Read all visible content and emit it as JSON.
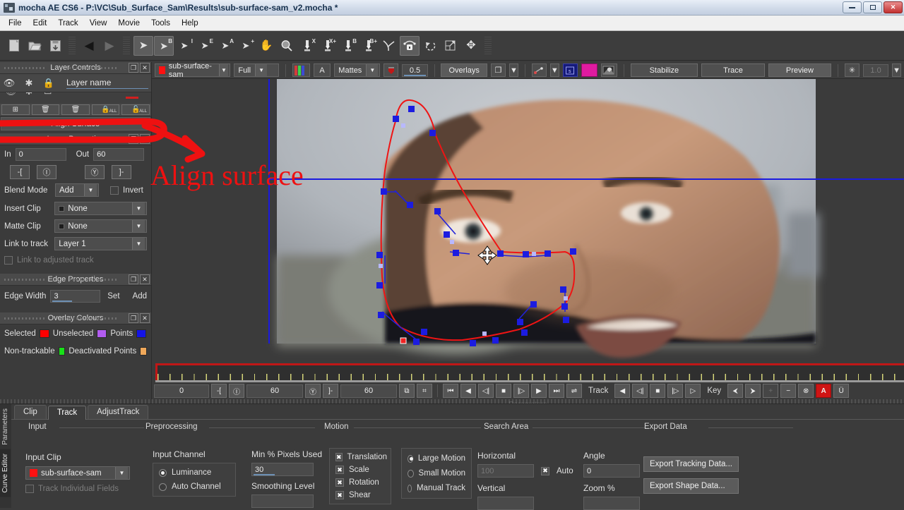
{
  "window": {
    "title": "mocha AE CS6 - P:\\VC\\Sub_Surface_Sam\\Results\\sub-surface-sam_v2.mocha *",
    "icon": "app-icon",
    "buttons": {
      "minimize": "–",
      "maximize": "▭",
      "close": "✕"
    }
  },
  "menu": {
    "items": [
      "File",
      "Edit",
      "Track",
      "View",
      "Movie",
      "Tools",
      "Help"
    ]
  },
  "toolbar": {
    "groups": [
      [
        {
          "name": "new-project-icon",
          "glyph": "🗋",
          "sup": ""
        },
        {
          "name": "open-project-icon",
          "glyph": "📁",
          "sup": ""
        },
        {
          "name": "save-project-icon",
          "glyph": "💾",
          "sup": ""
        }
      ],
      [
        {
          "name": "previous-icon",
          "glyph": "◀",
          "sup": ""
        },
        {
          "name": "next-icon",
          "glyph": "▶",
          "sup": ""
        }
      ],
      [
        {
          "name": "select-tool-icon",
          "glyph": "➤",
          "sup": "",
          "active": true
        },
        {
          "name": "select-b-tool-icon",
          "glyph": "➤",
          "sup": "B",
          "active": true
        },
        {
          "name": "select-i-tool-icon",
          "glyph": "➤",
          "sup": "I"
        },
        {
          "name": "select-e-tool-icon",
          "glyph": "➤",
          "sup": "E"
        },
        {
          "name": "select-a-tool-icon",
          "glyph": "➤",
          "sup": "A"
        },
        {
          "name": "add-point-tool-icon",
          "glyph": "➤",
          "sup": "+"
        }
      ],
      [
        {
          "name": "pan-hand-tool-icon",
          "glyph": "✋",
          "sup": ""
        },
        {
          "name": "zoom-tool-icon",
          "glyph": "🔍",
          "sup": ""
        },
        {
          "name": "xspline-tool-icon",
          "glyph": "✒",
          "sup": "X"
        },
        {
          "name": "xspline-add-tool-icon",
          "glyph": "✒",
          "sup": "X+"
        },
        {
          "name": "bezier-tool-icon",
          "glyph": "✒",
          "sup": "B"
        },
        {
          "name": "bezier-add-tool-icon",
          "glyph": "✒",
          "sup": "B+"
        },
        {
          "name": "magnetic-spline-tool-icon",
          "glyph": "⤵",
          "sup": ""
        },
        {
          "name": "align-surface-tool-icon",
          "glyph": "🔒",
          "sup": "",
          "active": true
        },
        {
          "name": "rotate-surface-tool-icon",
          "glyph": "↻",
          "sup": ""
        },
        {
          "name": "scale-surface-tool-icon",
          "glyph": "⬈",
          "sup": ""
        },
        {
          "name": "move-surface-tool-icon",
          "glyph": "✤",
          "sup": ""
        }
      ]
    ]
  },
  "layer_controls": {
    "panel_title": "Layer Controls",
    "header": {
      "visibility_icon": "eye-icon",
      "settings_icon": "gear-icon",
      "lock_icon": "lock-icon",
      "layer_name_label": "Layer name"
    },
    "tool_buttons": [
      {
        "name": "add-layer-button",
        "glyph": "➕"
      },
      {
        "name": "delete-layer-button",
        "glyph": "🗑"
      },
      {
        "name": "delete-keyframes-button",
        "glyph": "🗑"
      },
      {
        "name": "lock-all-button",
        "glyph": "🔒",
        "tiny": "ALL"
      },
      {
        "name": "unlock-all-button",
        "glyph": "🔓",
        "tiny": "ALL"
      }
    ],
    "align_surface_button": "Align Surface"
  },
  "layer_properties": {
    "panel_title": "Layer Properties",
    "in_label": "In",
    "in_value": "0",
    "out_label": "Out",
    "out_value": "60",
    "clip_buttons": [
      "-[",
      "Ⓘ",
      "Ⓨ",
      "]-"
    ],
    "blend_mode_label": "Blend Mode",
    "blend_mode_value": "Add",
    "invert_label": "Invert",
    "insert_clip_label": "Insert Clip",
    "insert_clip_value": "None",
    "matte_clip_label": "Matte Clip",
    "matte_clip_value": "None",
    "link_to_track_label": "Link to track",
    "link_to_track_value": "Layer 1",
    "link_adjusted_label": "Link to adjusted track"
  },
  "edge_properties": {
    "panel_title": "Edge Properties",
    "edge_width_label": "Edge Width",
    "edge_width_value": "3",
    "set_label": "Set",
    "add_label": "Add"
  },
  "overlay_colours": {
    "panel_title": "Overlay Colours",
    "entries": [
      {
        "label": "Selected",
        "color": "#ff0000"
      },
      {
        "label": "Unselected",
        "color": "#b25cf0"
      },
      {
        "label": "Points",
        "color": "#1414e6"
      },
      {
        "label": "Non-trackable",
        "color": "#18e018"
      },
      {
        "label": "Deactivated Points",
        "color": "#f0a85a"
      }
    ]
  },
  "viewer_toolbar": {
    "clip_name": "sub-surface-sam",
    "clip_swatch": "#ff1111",
    "zoom_value": "Full",
    "channel_icon": "rgb-channels-icon",
    "alpha_label": "A",
    "mattes_label": "Mattes",
    "matte_opacity": "0.5",
    "overlays_label": "Overlays",
    "surface_icon": "surface-icon",
    "spline_color_swatch": "#e01ba0",
    "stabilize_label": "Stabilize",
    "trace_label": "Trace",
    "preview_label": "Preview",
    "gain_icon": "brightness-icon",
    "gain_value": "1.0"
  },
  "timeline": {
    "in_value": "0",
    "mid_value": "60",
    "out_value": "60",
    "track_label": "Track",
    "key_label": "Key",
    "playback_buttons": [
      {
        "name": "go-to-start-button",
        "glyph": "⏮"
      },
      {
        "name": "play-backward-button",
        "glyph": "◀"
      },
      {
        "name": "step-back-button",
        "glyph": "◁|"
      },
      {
        "name": "stop-button",
        "glyph": "■"
      },
      {
        "name": "step-forward-button",
        "glyph": "|▷"
      },
      {
        "name": "play-forward-button",
        "glyph": "▶"
      },
      {
        "name": "go-to-end-button",
        "glyph": "⏭"
      },
      {
        "name": "loop-button",
        "glyph": "⇌"
      }
    ],
    "track_buttons": [
      {
        "name": "track-backward-all-button",
        "glyph": "◀"
      },
      {
        "name": "track-backward-button",
        "glyph": "◁|"
      },
      {
        "name": "track-stop-button",
        "glyph": "■"
      },
      {
        "name": "track-forward-button",
        "glyph": "|▷"
      },
      {
        "name": "track-forward-all-button",
        "glyph": "▷"
      }
    ],
    "key_buttons": [
      {
        "name": "previous-key-button",
        "glyph": "⮜"
      },
      {
        "name": "next-key-button",
        "glyph": "⮞"
      },
      {
        "name": "add-key-button",
        "glyph": "+",
        "disabled": true
      },
      {
        "name": "delete-key-button",
        "glyph": "−"
      },
      {
        "name": "delete-all-keys-button",
        "glyph": "⊗"
      },
      {
        "name": "auto-key-button",
        "glyph": "A",
        "red": true
      },
      {
        "name": "undo-key-button",
        "glyph": "Ü"
      }
    ],
    "in_buttons": [
      "-[",
      "Ⓘ",
      "Ⓨ",
      "]-"
    ],
    "extra_buttons": [
      {
        "name": "fit-timeline-button",
        "glyph": "⧉"
      },
      {
        "name": "frame-range-button",
        "glyph": "⌗"
      }
    ]
  },
  "parameters_panel": {
    "strip_title": "Parameters",
    "vertical_tabs": [
      "Parameters",
      "Curve Editor"
    ],
    "tabs": [
      {
        "label": "Clip",
        "active": false
      },
      {
        "label": "Track",
        "active": true
      },
      {
        "label": "AdjustTrack",
        "active": false
      }
    ],
    "groups": [
      "Input",
      "Preprocessing",
      "Motion",
      "Search Area",
      "Export Data"
    ],
    "input": {
      "input_clip_label": "Input Clip",
      "input_clip_value": "sub-surface-sam",
      "input_clip_swatch": "#ff1111",
      "track_individual_fields_label": "Track Individual Fields"
    },
    "preprocessing": {
      "input_channel_label": "Input Channel",
      "channel_options": [
        {
          "label": "Luminance",
          "selected": true
        },
        {
          "label": "Auto Channel",
          "selected": false
        }
      ],
      "min_pixels_label": "Min % Pixels Used",
      "min_pixels_value": "30",
      "smoothing_label": "Smoothing Level"
    },
    "motion": {
      "checks": [
        {
          "label": "Translation",
          "checked": true
        },
        {
          "label": "Scale",
          "checked": true
        },
        {
          "label": "Rotation",
          "checked": true
        },
        {
          "label": "Shear",
          "checked": true
        }
      ],
      "radios": [
        {
          "label": "Large Motion",
          "selected": true
        },
        {
          "label": "Small Motion",
          "selected": false
        },
        {
          "label": "Manual Track",
          "selected": false
        }
      ]
    },
    "search_area": {
      "horizontal_label": "Horizontal",
      "horizontal_value": "100",
      "auto_label": "Auto",
      "auto_checked": true,
      "vertical_label": "Vertical",
      "angle_label": "Angle",
      "angle_value": "0",
      "zoom_label": "Zoom %"
    },
    "export_data": {
      "export_tracking_label": "Export Tracking Data...",
      "export_shape_label": "Export Shape Data..."
    }
  },
  "annotation": {
    "text": "Align surface",
    "color": "#ee1111"
  }
}
